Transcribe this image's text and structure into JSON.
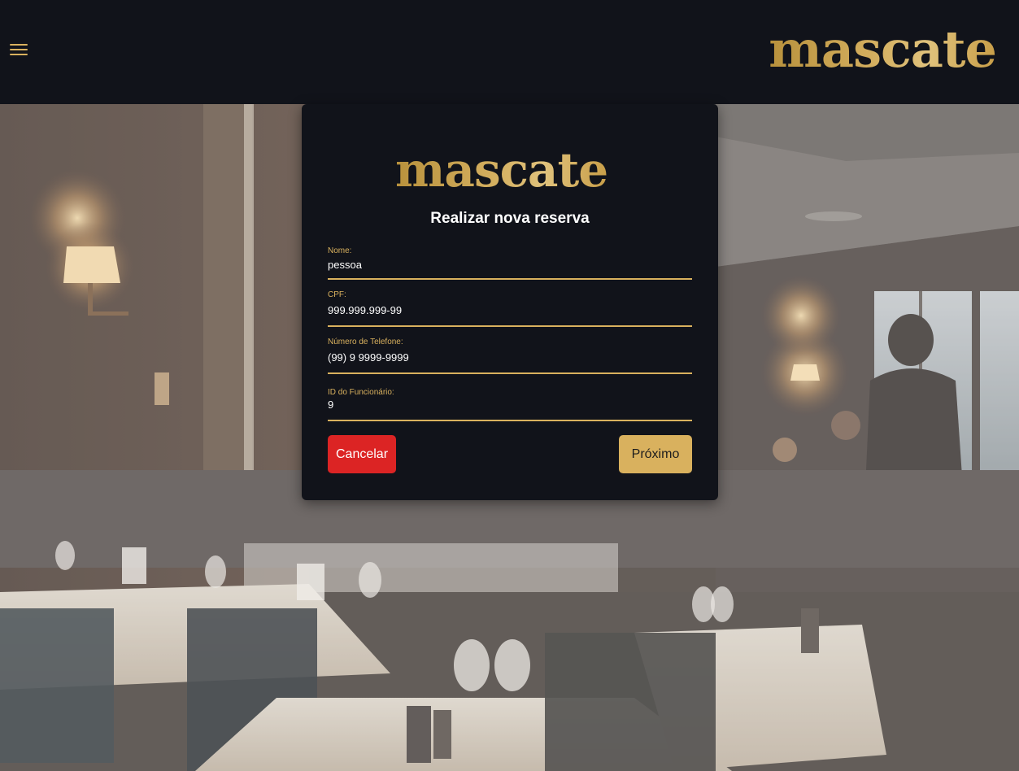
{
  "header": {
    "logo_text": "mascate",
    "menu_icon": "hamburger-menu-icon"
  },
  "modal": {
    "logo_text": "mascate",
    "title": "Realizar nova reserva",
    "fields": [
      {
        "label": "Nome:",
        "value": "pessoa"
      },
      {
        "label": "CPF:",
        "value": "999.999.999-99"
      },
      {
        "label": "Número de Telefone:",
        "value": "(99) 9 9999-9999"
      },
      {
        "label": "ID do Funcionário:",
        "value": "9"
      }
    ],
    "cancel_label": "Cancelar",
    "next_label": "Próximo"
  },
  "colors": {
    "brand_gold": "#d9b15e",
    "dark_background": "#11131a",
    "cancel_red": "#dc2424",
    "text_white": "#ffffff"
  }
}
